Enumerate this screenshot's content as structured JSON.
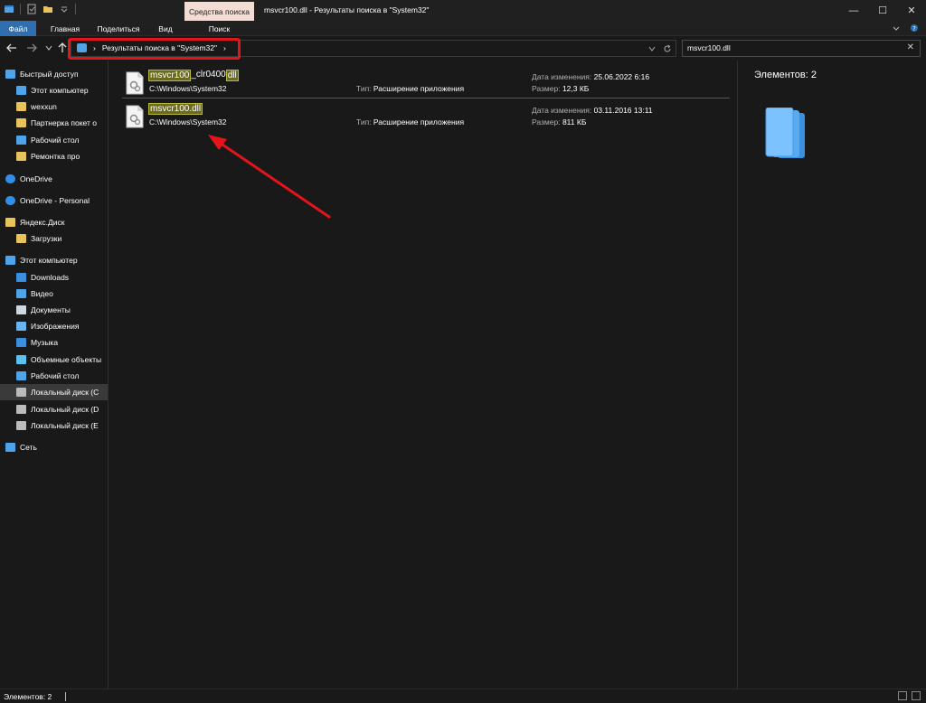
{
  "window": {
    "title": "msvcr100.dll - Результаты поиска в \"System32\"",
    "tools_tab": "Средства поиска",
    "btn_minimize": "—",
    "btn_maximize": "☐",
    "btn_close": "✕"
  },
  "ribbon": {
    "tabs": [
      "Файл",
      "Главная",
      "Поделиться",
      "Вид",
      "Поиск"
    ]
  },
  "address": {
    "crumb": "Результаты поиска в \"System32\"",
    "separator_left": "›",
    "separator_right": "›",
    "search_value": "msvcr100.dll"
  },
  "nav": {
    "items": [
      {
        "label": "Быстрый доступ",
        "icon": "star-icon"
      },
      {
        "label": "Этот компьютер",
        "icon": "pc-icon"
      },
      {
        "label": "wexxun",
        "icon": "folder-icon"
      },
      {
        "label": "Партнерка покет о",
        "icon": "folder-icon"
      },
      {
        "label": "Рабочий стол",
        "icon": "desktop-icon"
      },
      {
        "label": "Ремонтка про",
        "icon": "folder-icon"
      },
      {
        "label": "OneDrive",
        "icon": "cloud-icon"
      },
      {
        "label": "OneDrive - Personal",
        "icon": "cloud-icon"
      },
      {
        "label": "Яндекс.Диск",
        "icon": "yadisk-icon"
      },
      {
        "label": "Загрузки",
        "icon": "download-folder-icon"
      },
      {
        "label": "Этот компьютер",
        "icon": "pc-icon"
      },
      {
        "label": "Downloads",
        "icon": "download-arrow-icon"
      },
      {
        "label": "Видео",
        "icon": "video-icon"
      },
      {
        "label": "Документы",
        "icon": "document-icon"
      },
      {
        "label": "Изображения",
        "icon": "image-icon"
      },
      {
        "label": "Музыка",
        "icon": "music-icon"
      },
      {
        "label": "Объемные объекты",
        "icon": "cube-icon"
      },
      {
        "label": "Рабочий стол",
        "icon": "desktop-icon"
      },
      {
        "label": "Локальный диск (C",
        "icon": "drive-icon"
      },
      {
        "label": "Локальный диск (D",
        "icon": "drive-icon"
      },
      {
        "label": "Локальный диск (E",
        "icon": "drive-icon"
      },
      {
        "label": "Сеть",
        "icon": "network-icon"
      }
    ]
  },
  "results": [
    {
      "name_parts": [
        {
          "text": "msvcr100",
          "hl": true
        },
        {
          "text": "_clr0400",
          "hl": false
        },
        {
          "text": "dll",
          "hl": true
        }
      ],
      "path": "C:\\Windows\\System32",
      "type_label": "Тип:",
      "type_value": "Расширение приложения",
      "date_label": "Дата изменения:",
      "date_value": "25.06.2022 6:16",
      "size_label": "Размер:",
      "size_value": "12,3 КБ"
    },
    {
      "name_parts": [
        {
          "text": "msvcr100.dll",
          "hl": true
        }
      ],
      "path": "C:\\Windows\\System32",
      "type_label": "Тип:",
      "type_value": "Расширение приложения",
      "date_label": "Дата изменения:",
      "date_value": "03.11.2016 13:11",
      "size_label": "Размер:",
      "size_value": "811 КБ"
    }
  ],
  "details": {
    "count": "Элементов: 2"
  },
  "status": {
    "text": "Элементов: 2"
  },
  "colors": {
    "annotation": "#e4141b",
    "highlight": "#6b6b20"
  }
}
